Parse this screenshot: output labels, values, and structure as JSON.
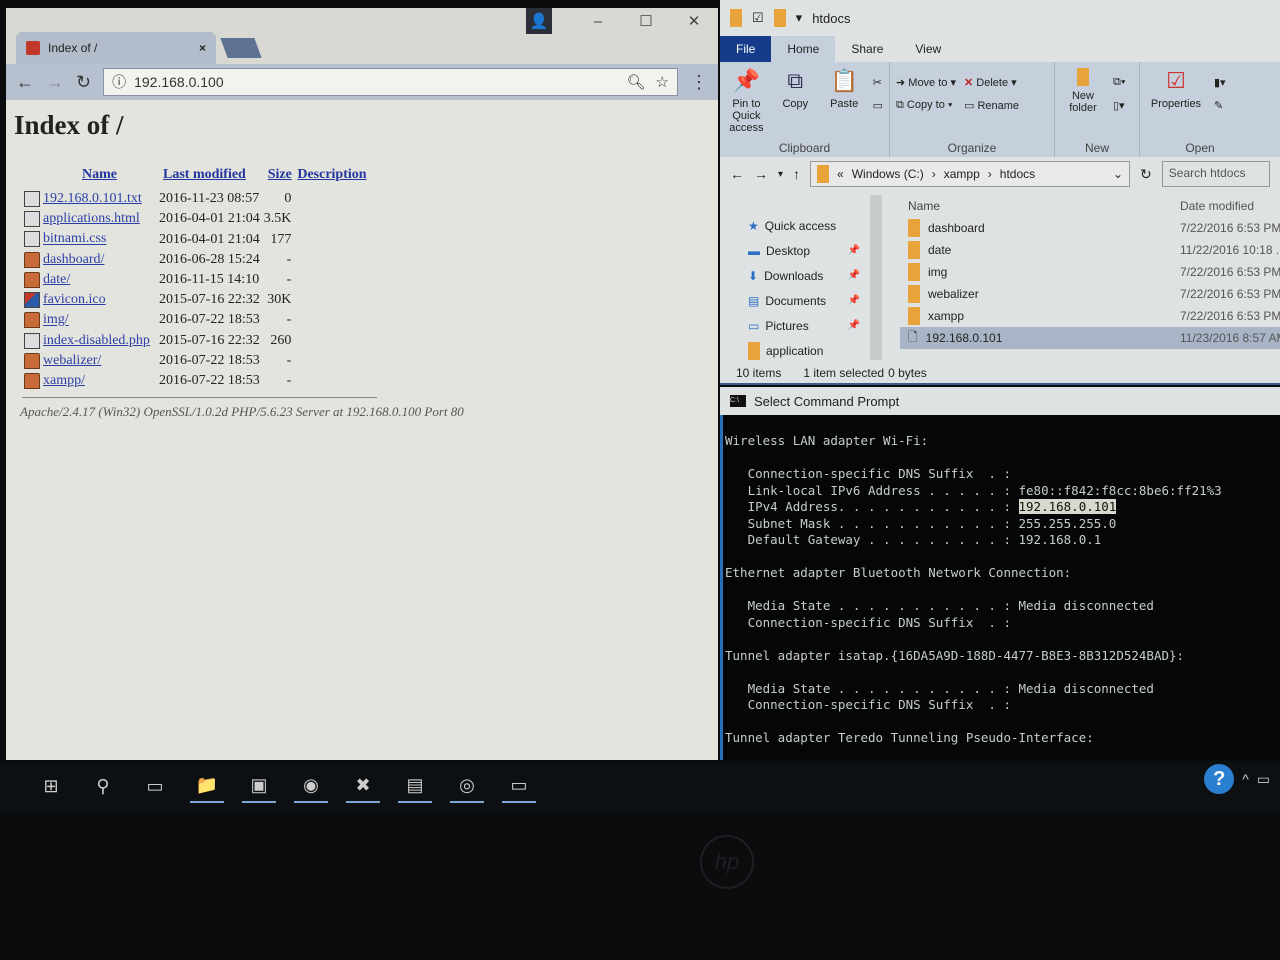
{
  "browser": {
    "tab_title": "Index of /",
    "url": "192.168.0.100",
    "page": {
      "heading": "Index of /",
      "columns": [
        "Name",
        "Last modified",
        "Size",
        "Description"
      ],
      "rows": [
        {
          "name": "192.168.0.101.txt",
          "modified": "2016-11-23 08:57",
          "size": "0",
          "type": "file"
        },
        {
          "name": "applications.html",
          "modified": "2016-04-01 21:04",
          "size": "3.5K",
          "type": "file"
        },
        {
          "name": "bitnami.css",
          "modified": "2016-04-01 21:04",
          "size": "177",
          "type": "file"
        },
        {
          "name": "dashboard/",
          "modified": "2016-06-28 15:24",
          "size": "-",
          "type": "dir"
        },
        {
          "name": "date/",
          "modified": "2016-11-15 14:10",
          "size": "-",
          "type": "dir"
        },
        {
          "name": "favicon.ico",
          "modified": "2015-07-16 22:32",
          "size": "30K",
          "type": "img"
        },
        {
          "name": "img/",
          "modified": "2016-07-22 18:53",
          "size": "-",
          "type": "dir"
        },
        {
          "name": "index-disabled.php",
          "modified": "2015-07-16 22:32",
          "size": "260",
          "type": "file"
        },
        {
          "name": "webalizer/",
          "modified": "2016-07-22 18:53",
          "size": "-",
          "type": "dir"
        },
        {
          "name": "xampp/",
          "modified": "2016-07-22 18:53",
          "size": "-",
          "type": "dir"
        }
      ],
      "footer": "Apache/2.4.17 (Win32) OpenSSL/1.0.2d PHP/5.6.23 Server at 192.168.0.100 Port 80"
    }
  },
  "explorer": {
    "title": "htdocs",
    "tabs": [
      "File",
      "Home",
      "Share",
      "View"
    ],
    "ribbon": {
      "pin": "Pin to Quick access",
      "copy": "Copy",
      "paste": "Paste",
      "clipboard": "Clipboard",
      "move_to": "Move to",
      "copy_to": "Copy to",
      "delete": "Delete",
      "rename": "Rename",
      "organize": "Organize",
      "new_folder": "New folder",
      "new": "New",
      "properties": "Properties",
      "open": "Open"
    },
    "path": [
      "Windows (C:)",
      "xampp",
      "htdocs"
    ],
    "search_placeholder": "Search htdocs",
    "nav": [
      {
        "label": "Quick access",
        "icon": "star"
      },
      {
        "label": "Desktop",
        "icon": "desktop"
      },
      {
        "label": "Downloads",
        "icon": "download"
      },
      {
        "label": "Documents",
        "icon": "document"
      },
      {
        "label": "Pictures",
        "icon": "picture"
      },
      {
        "label": "application",
        "icon": "folder"
      }
    ],
    "col_name": "Name",
    "col_date": "Date modified",
    "files": [
      {
        "name": "dashboard",
        "date": "7/22/2016 6:53 PM"
      },
      {
        "name": "date",
        "date": "11/22/2016 10:18 ..."
      },
      {
        "name": "img",
        "date": "7/22/2016 6:53 PM"
      },
      {
        "name": "webalizer",
        "date": "7/22/2016 6:53 PM"
      },
      {
        "name": "xampp",
        "date": "7/22/2016 6:53 PM"
      },
      {
        "name": "192.168.0.101",
        "date": "11/23/2016 8:57 AM",
        "selected": true
      }
    ],
    "status": {
      "items": "10 items",
      "selected": "1 item selected",
      "size": "0 bytes"
    }
  },
  "cmd": {
    "title": "Select Command Prompt",
    "lines": [
      "Wireless LAN adapter Wi-Fi:",
      "",
      "   Connection-specific DNS Suffix  . :",
      "   Link-local IPv6 Address . . . . . : fe80::f842:f8cc:8be6:ff21%3",
      "   IPv4 Address. . . . . . . . . . . : ",
      "   Subnet Mask . . . . . . . . . . . : 255.255.255.0",
      "   Default Gateway . . . . . . . . . : 192.168.0.1",
      "",
      "Ethernet adapter Bluetooth Network Connection:",
      "",
      "   Media State . . . . . . . . . . . : Media disconnected",
      "   Connection-specific DNS Suffix  . :",
      "",
      "Tunnel adapter isatap.{16DA5A9D-188D-4477-B8E3-8B312D524BAD}:",
      "",
      "   Media State . . . . . . . . . . . : Media disconnected",
      "   Connection-specific DNS Suffix  . :",
      "",
      "Tunnel adapter Teredo Tunneling Pseudo-Interface:"
    ],
    "highlighted_ip": "192.168.0.101"
  },
  "taskbar": {
    "apps": [
      "start",
      "search",
      "task-view",
      "file-explorer",
      "command-prompt",
      "app-circle",
      "xampp",
      "sublime",
      "chrome",
      "remote-desktop"
    ]
  },
  "colors": {
    "file_tab": "#163b8a",
    "link": "#2b3fa8",
    "cmd_bg": "#050607"
  }
}
